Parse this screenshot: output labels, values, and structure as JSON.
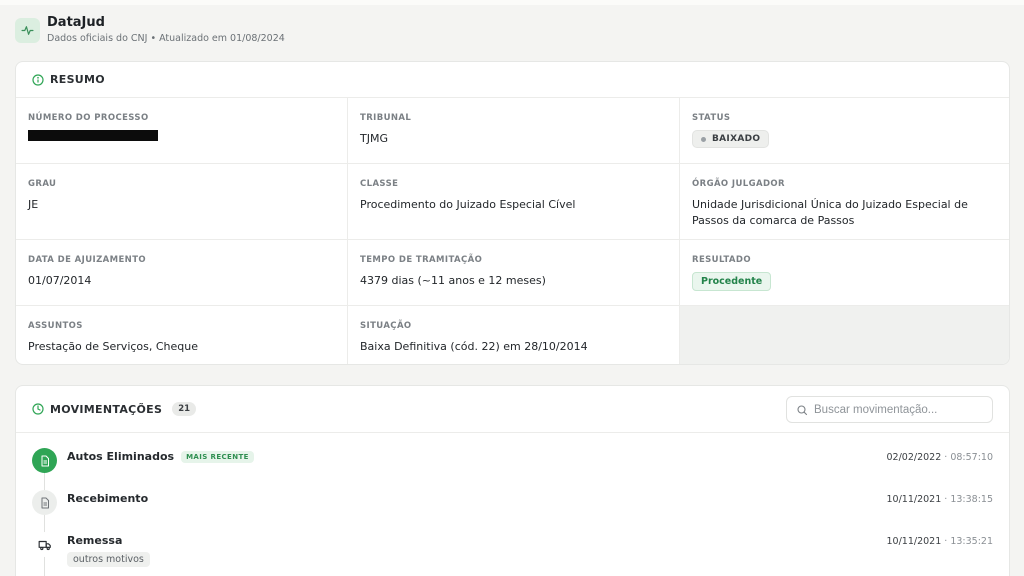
{
  "app": {
    "title": "DataJud",
    "subtitle": "Dados oficiais do CNJ • Atualizado em 01/08/2024"
  },
  "resumo": {
    "heading": "RESUMO",
    "fields": {
      "numero": {
        "label": "NÚMERO DO PROCESSO"
      },
      "tribunal": {
        "label": "TRIBUNAL",
        "value": "TJMG"
      },
      "status": {
        "label": "STATUS",
        "value": "BAIXADO"
      },
      "grau": {
        "label": "GRAU",
        "value": "JE"
      },
      "classe": {
        "label": "CLASSE",
        "value": "Procedimento do Juizado Especial Cível"
      },
      "orgao": {
        "label": "ÓRGÃO JULGADOR",
        "value": "Unidade Jurisdicional Única do Juizado Especial de Passos da comarca de Passos"
      },
      "data_ajuizamento": {
        "label": "DATA DE AJUIZAMENTO",
        "value": "01/07/2014"
      },
      "tempo": {
        "label": "TEMPO DE TRAMITAÇÃO",
        "value": "4379 dias (~11 anos e 12 meses)"
      },
      "resultado": {
        "label": "RESULTADO",
        "value": "Procedente"
      },
      "assuntos": {
        "label": "ASSUNTOS",
        "value": "Prestação de Serviços, Cheque"
      },
      "situacao": {
        "label": "SITUAÇÃO",
        "value": "Baixa Definitiva (cód. 22) em 28/10/2014"
      }
    }
  },
  "movimentacoes": {
    "heading": "MOVIMENTAÇÕES",
    "count": "21",
    "search_placeholder": "Buscar movimentação...",
    "items": [
      {
        "name": "Autos Eliminados",
        "badge": "MAIS RECENTE",
        "date": "02/02/2022",
        "time": " · 08:57:10",
        "icon": "document-icon"
      },
      {
        "name": "Recebimento",
        "date": "10/11/2021",
        "time": " · 13:38:15",
        "icon": "document-icon"
      },
      {
        "name": "Remessa",
        "tag": "outros motivos",
        "date": "10/11/2021",
        "time": " · 13:35:21",
        "icon": "truck-icon"
      }
    ]
  },
  "colors": {
    "accent_green": "#2fa555",
    "result_green": "#23834a",
    "background": "#f4f4f2"
  }
}
